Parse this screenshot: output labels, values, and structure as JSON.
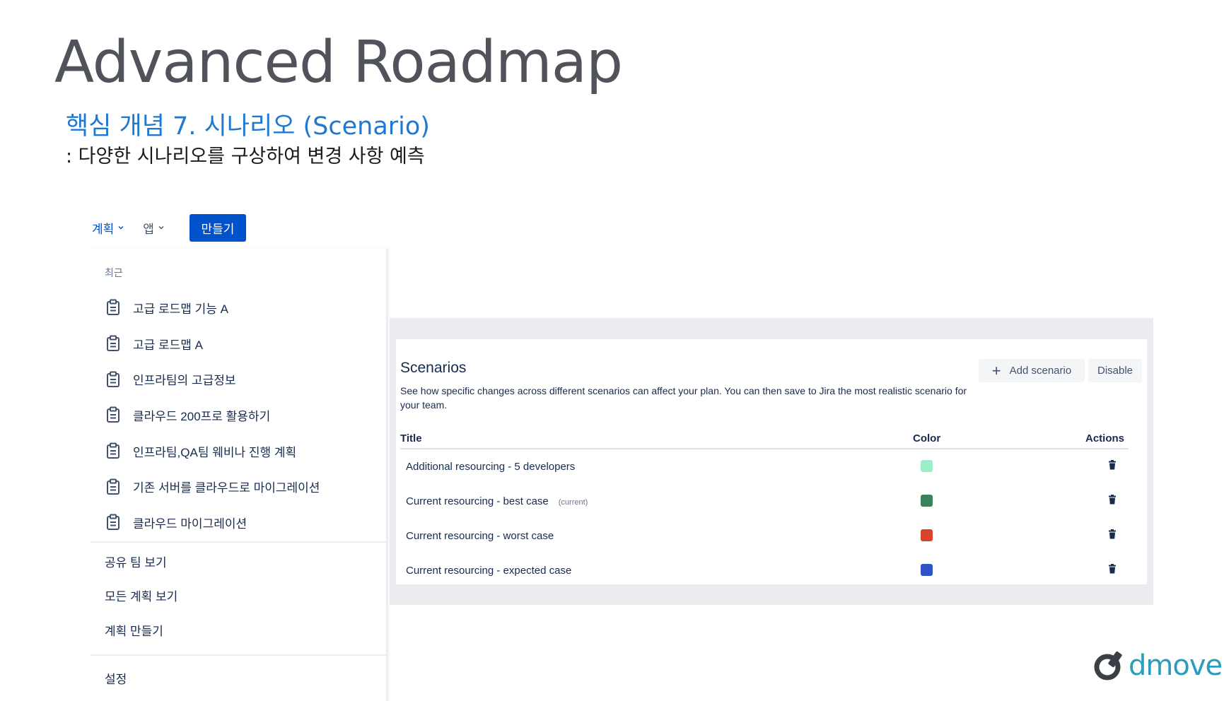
{
  "slide": {
    "title": "Advanced Roadmap",
    "subtitle": "핵심 개념 7. 시나리오 (Scenario)",
    "description": ": 다양한 시나리오를 구상하여 변경 사항 예측"
  },
  "topnav": {
    "items": [
      {
        "label": "계획",
        "icon": "chevron-down-icon"
      },
      {
        "label": "앱",
        "icon": "chevron-down-icon"
      }
    ],
    "create_label": "만들기"
  },
  "dropdown": {
    "recent_label": "최근",
    "recent_plans": [
      {
        "label": "고급 로드맵 기능 A",
        "icon": "plan-icon"
      },
      {
        "label": "고급 로드맵 A",
        "icon": "plan-icon"
      },
      {
        "label": "인프라팀의 고급정보",
        "icon": "plan-icon"
      },
      {
        "label": "클라우드 200프로 활용하기",
        "icon": "plan-icon"
      },
      {
        "label": "인프라팀,QA팀 웨비나 진행 계획",
        "icon": "plan-icon"
      },
      {
        "label": "기존 서버를 클라우드로 마이그레이션",
        "icon": "plan-icon"
      },
      {
        "label": "클라우드 마이그레이션",
        "icon": "plan-icon"
      }
    ],
    "links": [
      {
        "label": "공유 팀 보기"
      },
      {
        "label": "모든 계획 보기"
      },
      {
        "label": "계획 만들기"
      }
    ],
    "settings_label": "설정"
  },
  "scenarios": {
    "heading": "Scenarios",
    "description": "See how specific changes across different scenarios can affect your plan. You can then save to Jira the most realistic scenario for your team.",
    "add_label": "Add scenario",
    "disable_label": "Disable",
    "columns": {
      "title": "Title",
      "color": "Color",
      "actions": "Actions"
    },
    "rows": [
      {
        "title": "Additional resourcing - 5 developers",
        "tag": "",
        "color": "#9aefc7"
      },
      {
        "title": "Current resourcing - best case",
        "tag": "(current)",
        "color": "#3a8257"
      },
      {
        "title": "Current resourcing - worst case",
        "tag": "",
        "color": "#d8432b"
      },
      {
        "title": "Current resourcing - expected case",
        "tag": "",
        "color": "#2f52c6"
      }
    ]
  },
  "logo": {
    "text": "dmove",
    "color": "#2a9dbf"
  }
}
